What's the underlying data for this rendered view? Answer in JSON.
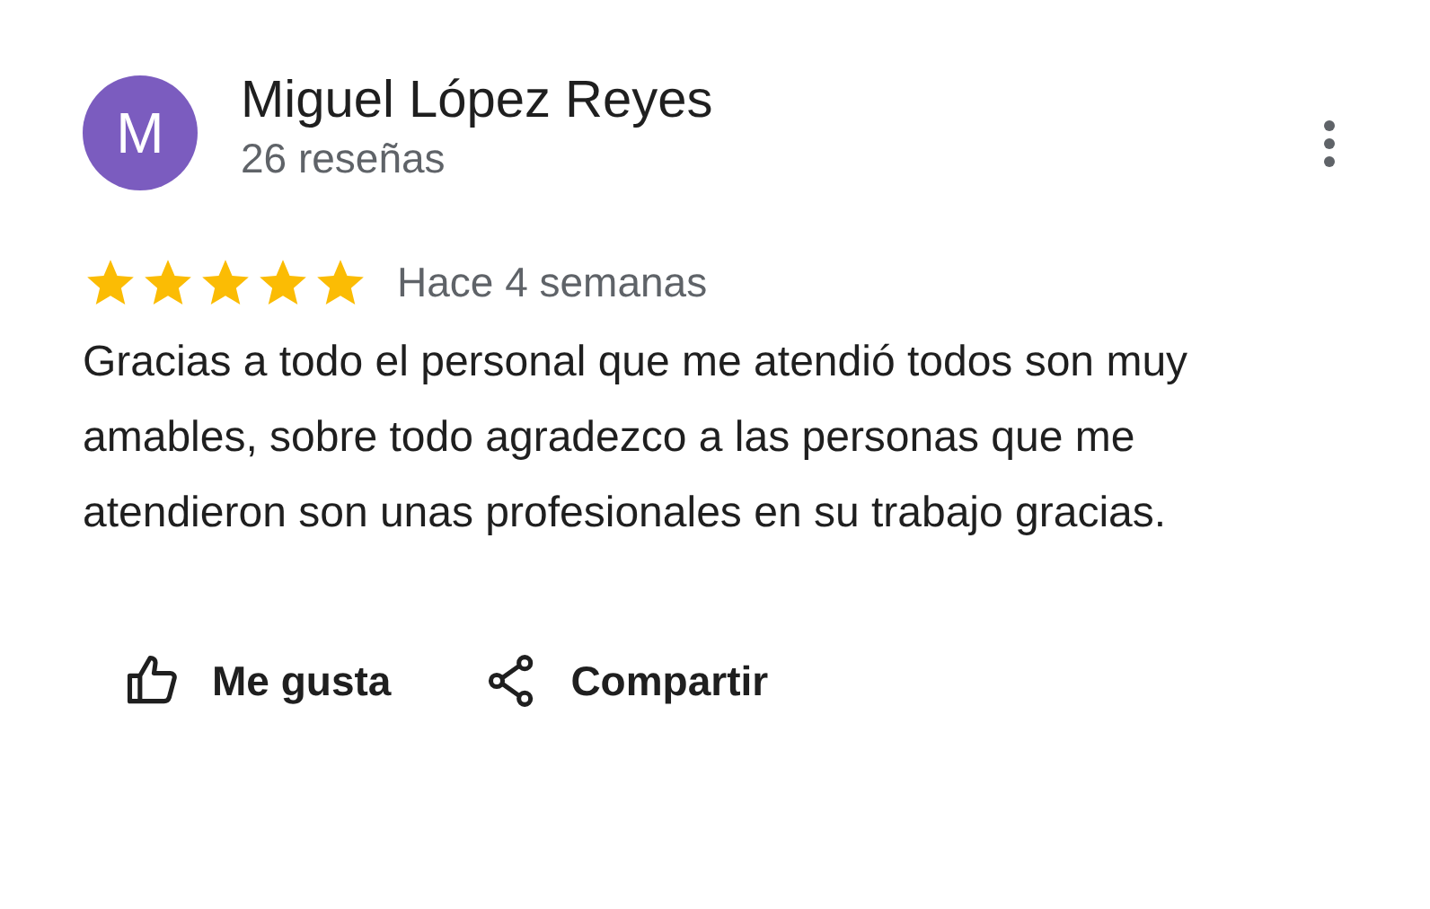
{
  "review": {
    "avatar_letter": "M",
    "author": "Miguel López Reyes",
    "review_count": "26 reseñas",
    "stars": 5,
    "time": "Hace 4 semanas",
    "text": "Gracias a todo el personal que me atendió todos son muy amables, sobre todo agradezco a las personas que me atendieron son unas profesionales en su trabajo gracias."
  },
  "actions": [
    {
      "kind": "like",
      "label": "Me gusta"
    },
    {
      "kind": "share",
      "label": "Compartir"
    }
  ]
}
